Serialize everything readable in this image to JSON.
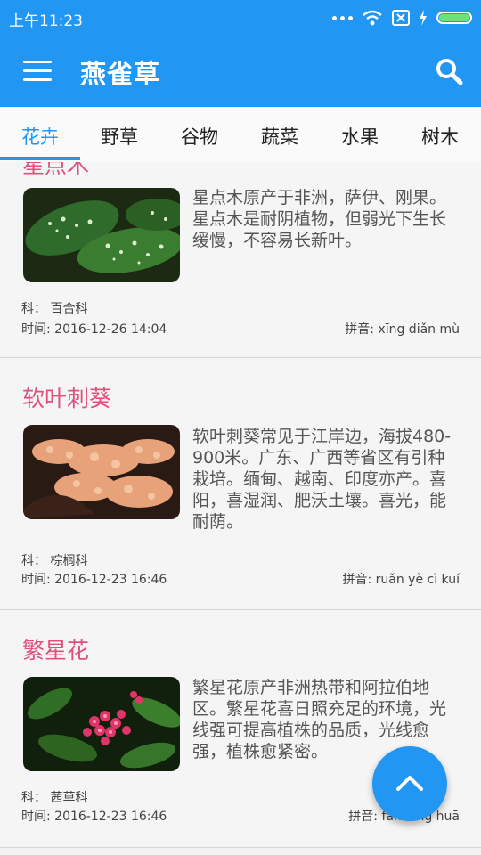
{
  "status_bar": {
    "time": "上午11:23"
  },
  "app_bar": {
    "title": "燕雀草"
  },
  "tabs": [
    {
      "label": "花卉",
      "active": true
    },
    {
      "label": "野草"
    },
    {
      "label": "谷物"
    },
    {
      "label": "蔬菜"
    },
    {
      "label": "水果"
    },
    {
      "label": "树木"
    }
  ],
  "items": [
    {
      "title": "星点木",
      "description": "星点木原产于非洲，萨伊、刚果。星点木是耐阴植物，但弱光下生长缓慢，不容易长新叶。",
      "family_label": "科：",
      "family": "百合科",
      "time_label": "时间:",
      "time": "2016-12-26 14:04",
      "pinyin_label": "拼音:",
      "pinyin": "xīng diǎn mù"
    },
    {
      "title": "软叶刺葵",
      "description": "软叶刺葵常见于江岸边，海拔480-900米。广东、广西等省区有引种栽培。缅甸、越南、印度亦产。喜阳，喜湿润、肥沃土壤。喜光，能耐荫。",
      "family_label": "科：",
      "family": "棕榈科",
      "time_label": "时间:",
      "time": "2016-12-23 16:46",
      "pinyin_label": "拼音:",
      "pinyin": "ruǎn yè cì kuí"
    },
    {
      "title": "繁星花",
      "description": "繁星花原产非洲热带和阿拉伯地区。繁星花喜日照充足的环境，光线强可提高植株的品质，光线愈强，植株愈紧密。",
      "family_label": "科：",
      "family": "茜草科",
      "time_label": "时间:",
      "time": "2016-12-23 16:46",
      "pinyin_label": "拼音:",
      "pinyin": "fán xīng huā"
    }
  ],
  "icons": {
    "menu": "menu-icon",
    "search": "search-icon",
    "scroll_top": "chevron-up-icon"
  },
  "colors": {
    "primary": "#2196f3",
    "title_pink": "#e0507a"
  }
}
